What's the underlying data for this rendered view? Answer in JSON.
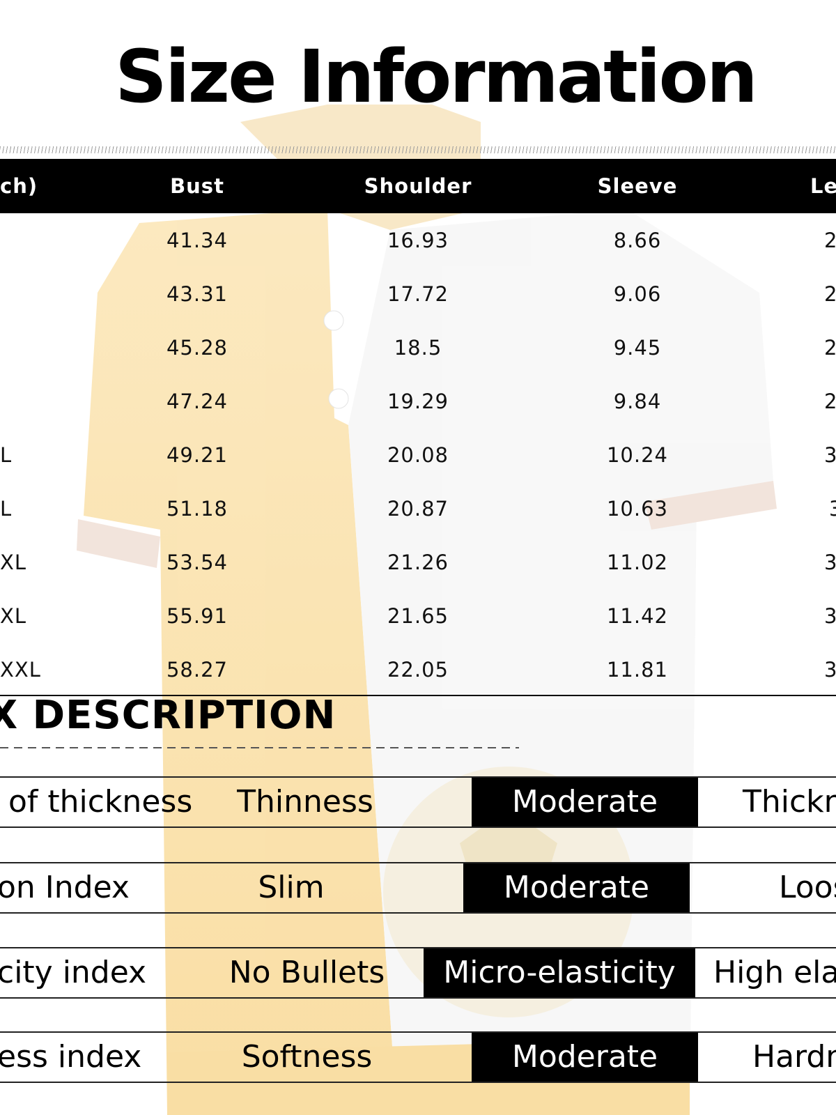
{
  "title": "Size Information",
  "size_table": {
    "headers": [
      "ch)",
      "Bust",
      "Shoulder",
      "Sleeve",
      "Le"
    ],
    "rows": [
      [
        "",
        "41.34",
        "16.93",
        "8.66",
        "2"
      ],
      [
        "",
        "43.31",
        "17.72",
        "9.06",
        "2"
      ],
      [
        "",
        "45.28",
        "18.5",
        "9.45",
        "2"
      ],
      [
        "",
        "47.24",
        "19.29",
        "9.84",
        "2"
      ],
      [
        "L",
        "49.21",
        "20.08",
        "10.24",
        "3"
      ],
      [
        "L",
        "51.18",
        "20.87",
        "10.63",
        "3"
      ],
      [
        "XL",
        "53.54",
        "21.26",
        "11.02",
        "3"
      ],
      [
        "XL",
        "55.91",
        "21.65",
        "11.42",
        "3"
      ],
      [
        "XXL",
        "58.27",
        "22.05",
        "11.81",
        "3"
      ]
    ]
  },
  "index_section": {
    "title": "X DESCRIPTION",
    "rows": [
      {
        "label": "of thickness",
        "options": [
          "Thinness",
          "Moderate",
          "Thickn"
        ],
        "selected": 1
      },
      {
        "label": "on Index",
        "options": [
          "Slim",
          "Moderate",
          "Loos"
        ],
        "selected": 1
      },
      {
        "label": "city index",
        "options": [
          "No Bullets",
          "Micro-elasticity",
          "High ela"
        ],
        "selected": 1
      },
      {
        "label": "ess index",
        "options": [
          "Softness",
          "Moderate",
          "Hardn"
        ],
        "selected": 1
      }
    ]
  },
  "colors": {
    "garment_yellow": "#f7c763",
    "header_bg": "#000000",
    "selected_bg": "#000000"
  }
}
